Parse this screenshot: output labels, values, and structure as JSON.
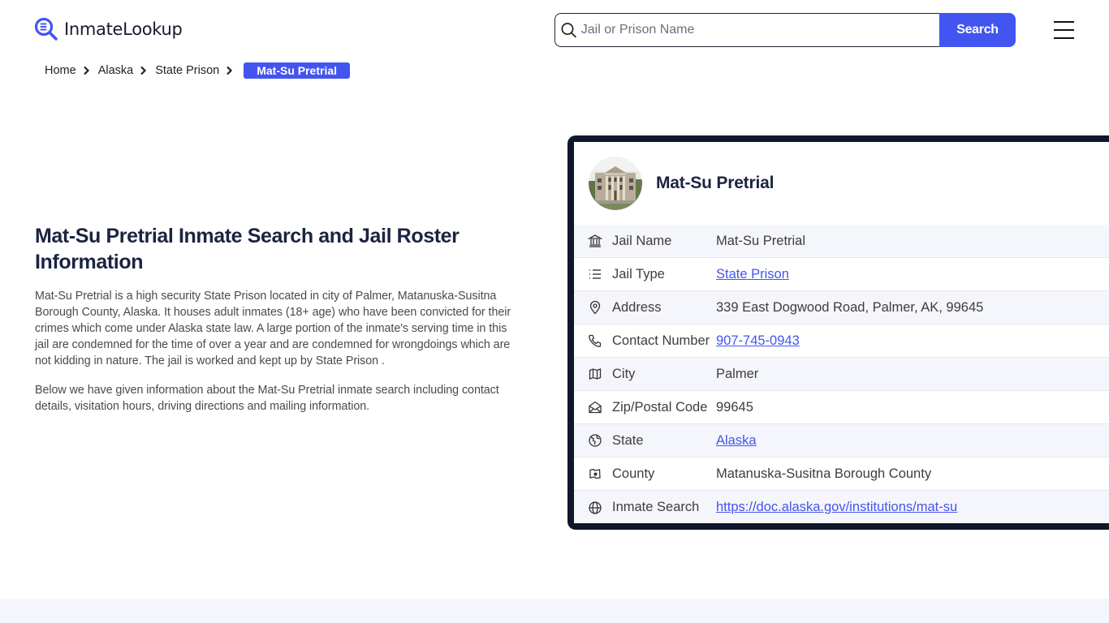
{
  "header": {
    "logo_text": "InmateLookup",
    "search": {
      "placeholder": "Jail or Prison Name",
      "value": "",
      "button_label": "Search"
    },
    "menu_icon": "hamburger-menu-icon"
  },
  "breadcrumb": {
    "items": [
      "Home",
      "Alaska",
      "State Prison"
    ],
    "current": "Mat-Su Pretrial"
  },
  "intro": {
    "title": "Mat-Su Pretrial Inmate Search and Jail Roster Information",
    "paragraphs": [
      "Mat-Su Pretrial is a high security State Prison located in city of Palmer, Matanuska-Susitna Borough County, Alaska. It houses adult inmates (18+ age) who have been convicted for their crimes which come under Alaska state law. A large portion of the inmate's serving time in this jail are condemned for the time of over a year and are condemned for wrongdoings which are not kidding in nature. The jail is worked and kept up by State Prison .",
      "Below we have given information about the Mat-Su Pretrial inmate search including contact details, visitation hours, driving directions and mailing information."
    ]
  },
  "card": {
    "title": "Mat-Su Pretrial",
    "rows": [
      {
        "icon": "building-columns-icon",
        "label": "Jail Name",
        "value": "Mat-Su Pretrial",
        "link": false
      },
      {
        "icon": "list-icon",
        "label": "Jail Type",
        "value": "State Prison",
        "link": true
      },
      {
        "icon": "map-pin-icon",
        "label": "Address",
        "value": "339 East Dogwood Road, Palmer, AK, 99645",
        "link": false
      },
      {
        "icon": "phone-icon",
        "label": "Contact Number",
        "value": "907-745-0943",
        "link": true
      },
      {
        "icon": "map-icon",
        "label": "City",
        "value": "Palmer",
        "link": false
      },
      {
        "icon": "mail-open-icon",
        "label": "Zip/Postal Code",
        "value": "99645",
        "link": false
      },
      {
        "icon": "globe-region-icon",
        "label": "State",
        "value": "Alaska",
        "link": true
      },
      {
        "icon": "county-map-icon",
        "label": "County",
        "value": "Matanuska-Susitna Borough County",
        "link": false
      },
      {
        "icon": "globe-icon",
        "label": "Inmate Search",
        "value": "https://doc.alaska.gov/institutions/mat-su",
        "link": true
      }
    ]
  },
  "colors": {
    "accent": "#4355f0",
    "card_border": "#0f172a",
    "row_alt": "#f5f6fb",
    "heading": "#1b2440"
  }
}
